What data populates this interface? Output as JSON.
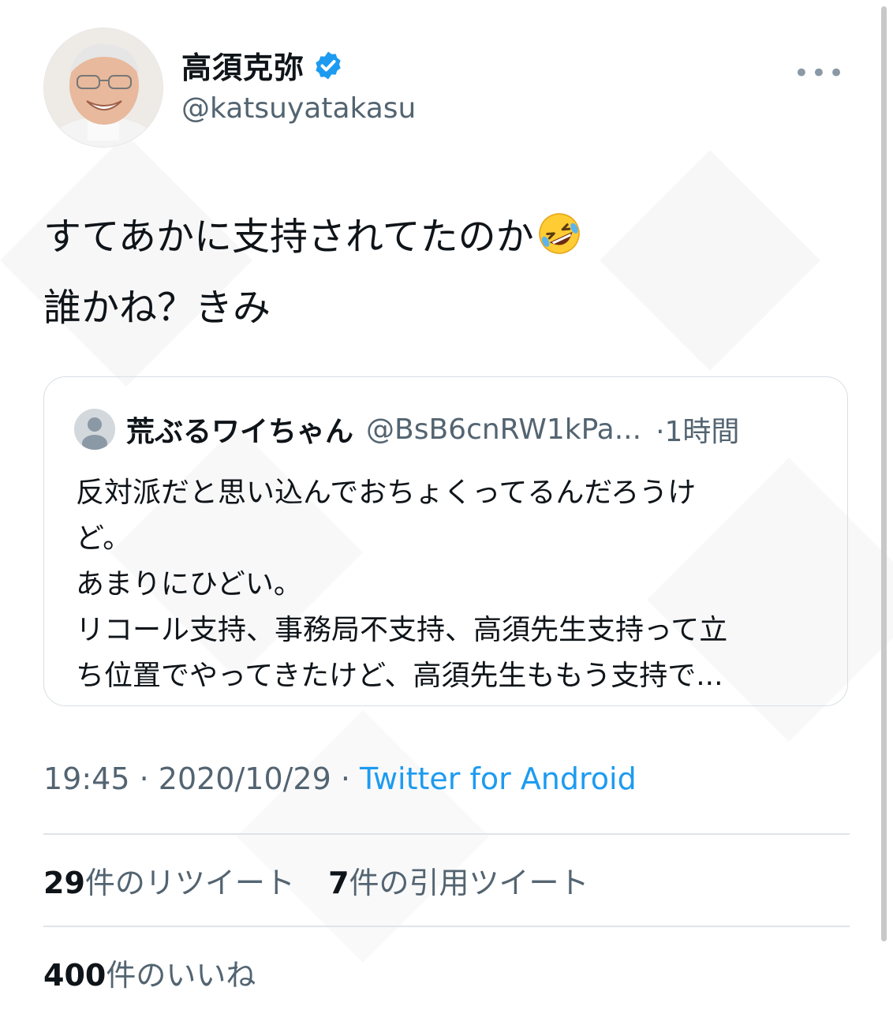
{
  "author": {
    "display_name": "高須克弥",
    "handle": "@katsuyatakasu",
    "verified": true
  },
  "tweet": {
    "lines": [
      "すてあかに支持されてたのか",
      "誰かね？きみ"
    ],
    "emoji": "rolling-on-floor-laughing-emoji"
  },
  "quote": {
    "display_name": "荒ぶるワイちゃん",
    "handle": "@BsB6cnRW1kPa...",
    "time": "·1時間",
    "lines": [
      "反対派だと思い込んでおちょくってるんだろうけ",
      "ど。",
      "あまりにひどい。",
      "リコール支持、事務局不支持、高須先生支持って立",
      "ち位置でやってきたけど、高須先生ももう支持で..."
    ]
  },
  "meta": {
    "time": "19:45",
    "date": "2020/10/29",
    "separator": " · ",
    "source": "Twitter for Android"
  },
  "stats": {
    "retweets": "29",
    "retweets_label": "件のリツイート",
    "quotes": "7",
    "quotes_label": "件の引用ツイート",
    "likes": "400",
    "likes_label": "件のいいね"
  },
  "colors": {
    "link": "#1d9bf0",
    "secondary_text": "#536471",
    "verified": "#1d9bf0"
  }
}
